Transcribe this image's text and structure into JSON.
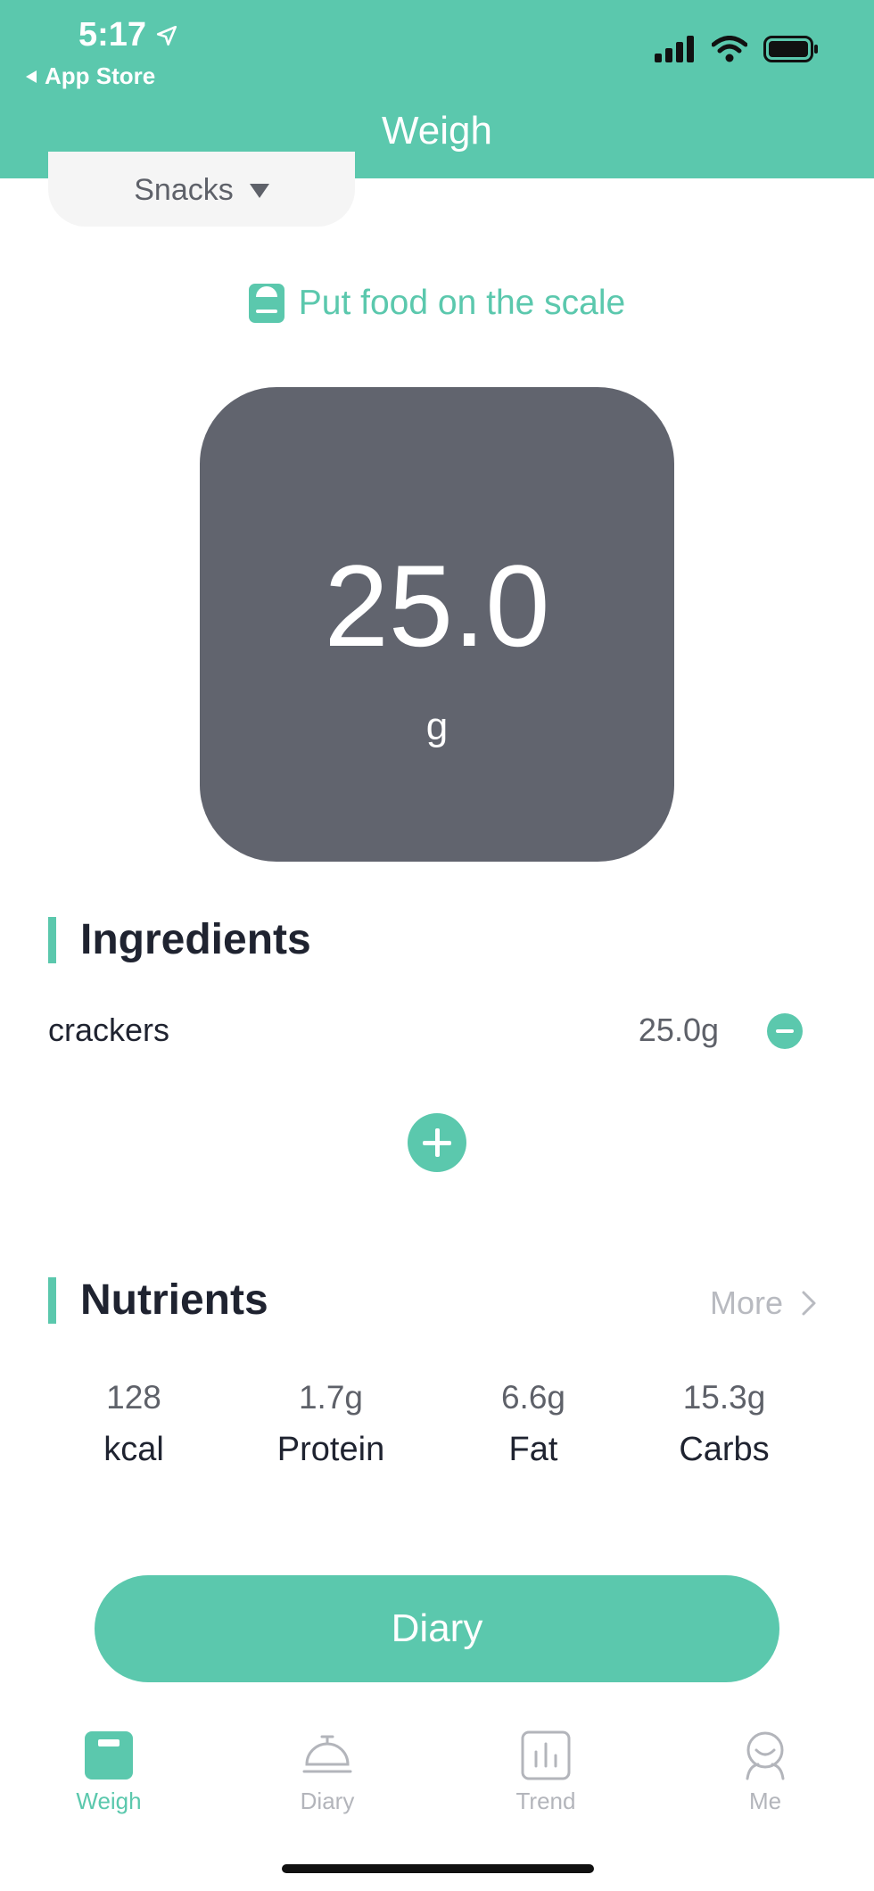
{
  "status_bar": {
    "time": "5:17",
    "back_label": "App Store"
  },
  "header": {
    "title": "Weigh"
  },
  "meal_selector": {
    "label": "Snacks"
  },
  "scale": {
    "hint": "Put food on the scale",
    "weight": "25.0",
    "unit": "g"
  },
  "ingredients": {
    "title": "Ingredients",
    "items": [
      {
        "name": "crackers",
        "weight": "25.0g"
      }
    ]
  },
  "nutrients": {
    "title": "Nutrients",
    "more_label": "More",
    "items": [
      {
        "value": "128",
        "label": "kcal"
      },
      {
        "value": "1.7g",
        "label": "Protein"
      },
      {
        "value": "6.6g",
        "label": "Fat"
      },
      {
        "value": "15.3g",
        "label": "Carbs"
      }
    ]
  },
  "diary_button": {
    "label": "Diary"
  },
  "tabs": [
    {
      "label": "Weigh",
      "icon": "scale-icon",
      "active": true
    },
    {
      "label": "Diary",
      "icon": "cloche-icon",
      "active": false
    },
    {
      "label": "Trend",
      "icon": "bar-chart-icon",
      "active": false
    },
    {
      "label": "Me",
      "icon": "person-icon",
      "active": false
    }
  ],
  "colors": {
    "accent": "#5bc8ad",
    "display": "#61646e",
    "muted": "#b3b5bb",
    "text": "#1f2330"
  }
}
